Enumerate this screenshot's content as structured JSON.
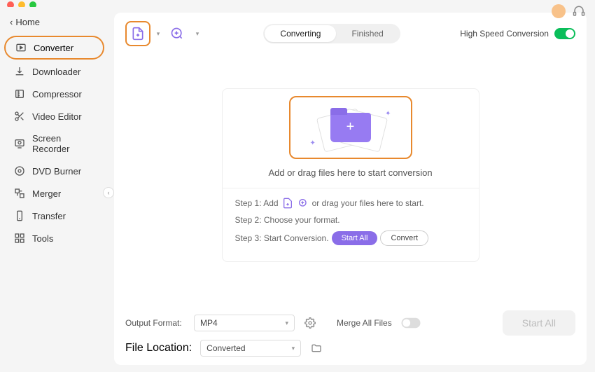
{
  "back_label": "Home",
  "sidebar": {
    "items": [
      {
        "label": "Converter"
      },
      {
        "label": "Downloader"
      },
      {
        "label": "Compressor"
      },
      {
        "label": "Video Editor"
      },
      {
        "label": "Screen Recorder"
      },
      {
        "label": "DVD Burner"
      },
      {
        "label": "Merger"
      },
      {
        "label": "Transfer"
      },
      {
        "label": "Tools"
      }
    ]
  },
  "tabs": {
    "converting": "Converting",
    "finished": "Finished"
  },
  "speed_label": "High Speed Conversion",
  "dropzone": {
    "hint": "Add or drag files here to start conversion",
    "step1_a": "Step 1: Add",
    "step1_b": "or drag your files here to start.",
    "step2": "Step 2: Choose your format.",
    "step3": "Step 3: Start Conversion.",
    "start_all_btn": "Start  All",
    "convert_btn": "Convert"
  },
  "bottom": {
    "output_format_label": "Output Format:",
    "output_format_value": "MP4",
    "file_location_label": "File Location:",
    "file_location_value": "Converted",
    "merge_label": "Merge All Files",
    "start_all": "Start All"
  }
}
